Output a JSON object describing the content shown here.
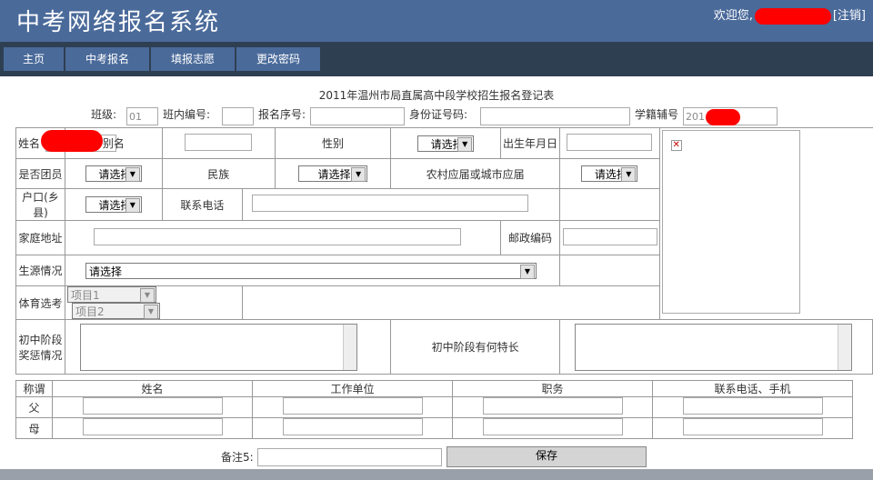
{
  "header": {
    "title": "中考网络报名系统",
    "welcome": "欢迎您,",
    "logout_prefix": "[",
    "logout": "注销",
    "logout_suffix": "]"
  },
  "nav": [
    "主页",
    "中考报名",
    "填报志愿",
    "更改密码"
  ],
  "form": {
    "title": "2011年温州市局直属高中段学校招生报名登记表",
    "class_label": "班级:",
    "class_value": "01",
    "class_no_label": "班内编号:",
    "reg_no_label": "报名序号:",
    "idcard_label": "身份证号码:",
    "student_id_label": "学籍辅号",
    "student_id_value": "201",
    "name_label": "姓名",
    "alias_label": "别名",
    "gender_label": "性别",
    "birth_label": "出生年月日",
    "league_label": "是否团员",
    "ethnicity_label": "民族",
    "graduate_type_label": "农村应届或城市应届",
    "hukou_label": "户口(乡县)",
    "phone_label": "联系电话",
    "address_label": "家庭地址",
    "postcode_label": "邮政编码",
    "origin_label": "生源情况",
    "pe_label": "体育选考",
    "awards_label": "初中阶段奖惩情况",
    "talents_label": "初中阶段有何特长",
    "select_placeholder": "请选择",
    "pe_item1": "项目1",
    "pe_item2": "项目2",
    "photo_icon": "broken-image-icon"
  },
  "parents": {
    "headers": [
      "称谓",
      "姓名",
      "工作单位",
      "职务",
      "联系电话、手机"
    ],
    "rows": [
      "父",
      "母"
    ]
  },
  "remark_label": "备注5:",
  "save_label": "保存"
}
